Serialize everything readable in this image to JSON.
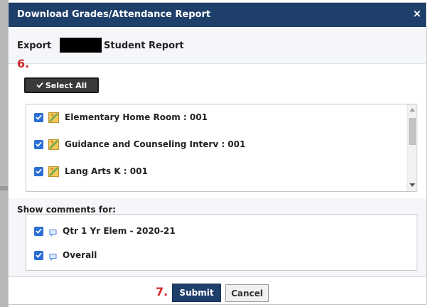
{
  "dialog": {
    "title": "Download Grades/Attendance Report",
    "close_glyph": "×"
  },
  "export": {
    "prefix": "Export",
    "suffix": "Student Report"
  },
  "annotations": {
    "step6": "6.",
    "step7": "7."
  },
  "select_all": {
    "label": "Select All",
    "icon": "checkmark-icon"
  },
  "courses": [
    {
      "label": "Elementary Home Room : 001",
      "checked": true,
      "icon": "course-icon"
    },
    {
      "label": "Guidance and Counseling Interv : 001",
      "checked": true,
      "icon": "course-icon"
    },
    {
      "label": "Lang Arts K : 001",
      "checked": true,
      "icon": "course-icon"
    }
  ],
  "comments": {
    "title": "Show comments for:",
    "items": [
      {
        "label": "Qtr 1 Yr Elem - 2020-21",
        "checked": true,
        "icon": "comment-bubble-icon"
      },
      {
        "label": "Overall",
        "checked": true,
        "icon": "comment-bubble-icon"
      }
    ]
  },
  "footer": {
    "submit_label": "Submit",
    "cancel_label": "Cancel"
  },
  "colors": {
    "titlebar": "#1f3f6b",
    "checkbox": "#2b6fd4",
    "annotation": "#d32828"
  }
}
